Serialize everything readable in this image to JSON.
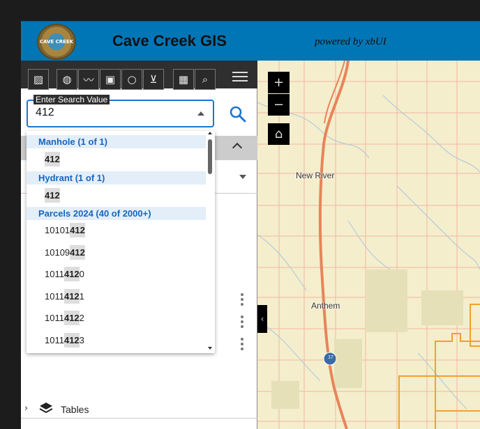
{
  "header": {
    "logo_text": "CAVE CREEK",
    "title": "Cave Creek GIS",
    "powered_by": "powered by xbUI"
  },
  "toolbar": {
    "tools": [
      {
        "icon": "edit-square-icon",
        "glyph": "▨"
      },
      {
        "icon": "map-pin-icon",
        "glyph": "◍"
      },
      {
        "icon": "polyline-icon",
        "glyph": "〰"
      },
      {
        "icon": "rectangle-draw-icon",
        "glyph": "▣"
      },
      {
        "icon": "circle-draw-icon",
        "glyph": "○"
      },
      {
        "icon": "polygon-draw-icon",
        "glyph": "⊻"
      },
      {
        "icon": "table-icon",
        "glyph": "▦"
      },
      {
        "icon": "search-icon",
        "glyph": "⌕"
      }
    ]
  },
  "search": {
    "label": "Enter Search Value",
    "value": "412"
  },
  "results": {
    "groups": [
      {
        "title": "Manhole (1 of 1)",
        "items": [
          [
            "",
            "412",
            ""
          ]
        ]
      },
      {
        "title": "Hydrant (1 of 1)",
        "items": [
          [
            "",
            "412",
            ""
          ]
        ]
      },
      {
        "title": "Parcels 2024 (40 of 2000+)",
        "items": [
          [
            "10101",
            "412",
            ""
          ],
          [
            "10109",
            "412",
            ""
          ],
          [
            "1011",
            "412",
            "0"
          ],
          [
            "1011",
            "412",
            "1"
          ],
          [
            "1011",
            "412",
            "2"
          ],
          [
            "1011",
            "412",
            "3"
          ]
        ]
      }
    ]
  },
  "panel": {
    "tables_label": "Tables"
  },
  "map": {
    "zoom_in": "+",
    "zoom_out": "−",
    "home_glyph": "⌂",
    "collapse_glyph": "‹",
    "places": [
      "New River",
      "Anthem"
    ],
    "highway_shield": "17"
  },
  "colors": {
    "header_bg": "#0076b6",
    "accent": "#1976d2",
    "map_base": "#f4eecc",
    "highway": "#e8845a",
    "parcel_outline": "#f0a030"
  }
}
